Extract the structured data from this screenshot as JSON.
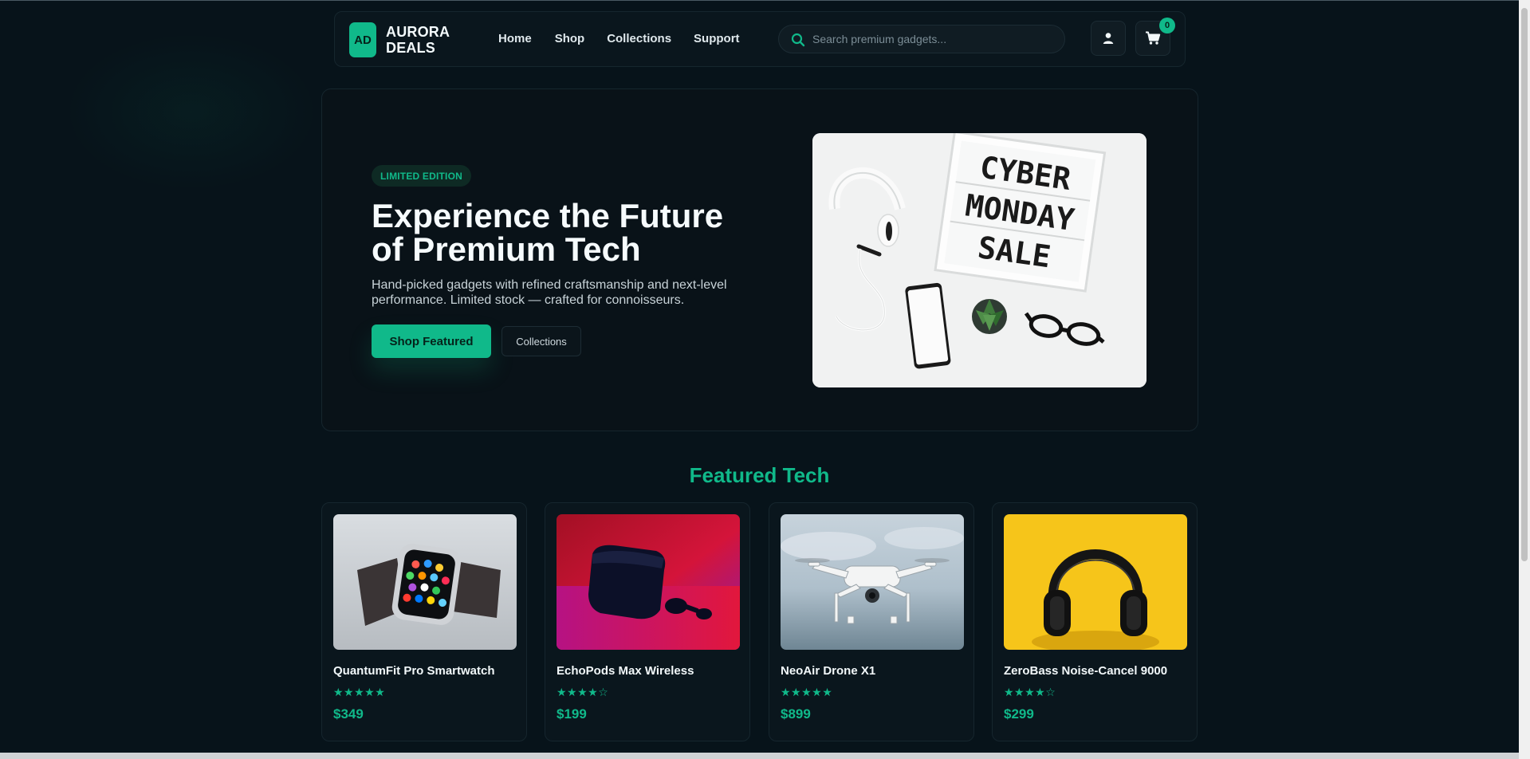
{
  "brand": {
    "badge": "AD",
    "name_line1": "AURORA",
    "name_line2": "DEALS"
  },
  "nav": {
    "links": [
      "Home",
      "Shop",
      "Collections",
      "Support"
    ]
  },
  "search": {
    "placeholder": "Search premium gadgets..."
  },
  "cart": {
    "count": "0"
  },
  "hero": {
    "badge": "LIMITED EDITION",
    "title_line1": "Experience the Future",
    "title_line2": "of Premium Tech",
    "subtitle": "Hand-picked gadgets with refined craftsmanship and next-level performance. Limited stock — crafted for connoisseurs.",
    "primary_cta": "Shop Featured",
    "secondary_cta": "Collections",
    "image_sign_lines": [
      "CYBER",
      "MONDAY",
      "SALE"
    ]
  },
  "featured": {
    "title": "Featured Tech",
    "products": [
      {
        "name": "QuantumFit Pro Smartwatch",
        "stars": "★★★★★",
        "rating": 5,
        "price": "$349"
      },
      {
        "name": "EchoPods Max Wireless",
        "stars": "★★★★☆",
        "rating": 4,
        "price": "$199"
      },
      {
        "name": "NeoAir Drone X1",
        "stars": "★★★★★",
        "rating": 5,
        "price": "$899"
      },
      {
        "name": "ZeroBass Noise-Cancel 9000",
        "stars": "★★★★☆",
        "rating": 4,
        "price": "$299"
      }
    ]
  },
  "colors": {
    "accent": "#10b98a",
    "background": "#07131a",
    "panel": "#0a161d"
  }
}
